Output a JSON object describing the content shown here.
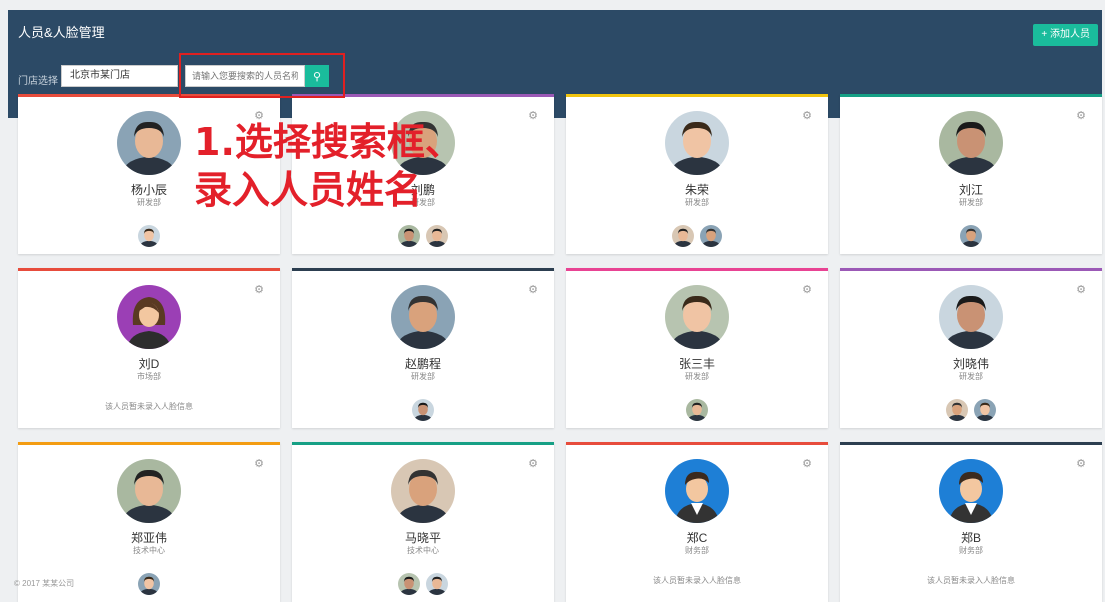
{
  "header": {
    "title": "人员&人脸管理",
    "add_button": "+ 添加人员",
    "filter_label": "门店选择",
    "store_select": "北京市某门店",
    "search_placeholder": "请输入您要搜索的人员名称",
    "search_icon": "search-icon"
  },
  "annotation": {
    "line1": "1.选择搜索框、",
    "line2": "录入人员姓名",
    "color": "#e3202a"
  },
  "cards": [
    {
      "name": "杨小辰",
      "dept": "研发部",
      "border": "#e74c3c",
      "avatar": "photo",
      "thumbs": 1,
      "note": ""
    },
    {
      "name": "刘鹏",
      "dept": "研发部",
      "border": "#9b59b6",
      "avatar": "photo",
      "thumbs": 2,
      "note": ""
    },
    {
      "name": "朱荣",
      "dept": "研发部",
      "border": "#f1c40f",
      "avatar": "photo",
      "thumbs": 2,
      "note": ""
    },
    {
      "name": "刘江",
      "dept": "研发部",
      "border": "#16a085",
      "avatar": "photo",
      "thumbs": 1,
      "note": ""
    },
    {
      "name": "刘D",
      "dept": "市场部",
      "border": "#e74c3c",
      "avatar": "female-cartoon",
      "thumbs": 0,
      "note": "该人员暂未录入人脸信息"
    },
    {
      "name": "赵鹏程",
      "dept": "研发部",
      "border": "#2c3e50",
      "avatar": "photo",
      "thumbs": 1,
      "note": ""
    },
    {
      "name": "张三丰",
      "dept": "研发部",
      "border": "#e84393",
      "avatar": "photo",
      "thumbs": 1,
      "note": ""
    },
    {
      "name": "刘晓伟",
      "dept": "研发部",
      "border": "#9b59b6",
      "avatar": "photo",
      "thumbs": 2,
      "note": ""
    },
    {
      "name": "郑亚伟",
      "dept": "技术中心",
      "border": "#f39c12",
      "avatar": "photo",
      "thumbs": 1,
      "note": ""
    },
    {
      "name": "马晓平",
      "dept": "技术中心",
      "border": "#16a085",
      "avatar": "photo",
      "thumbs": 2,
      "note": ""
    },
    {
      "name": "郑C",
      "dept": "财务部",
      "border": "#e74c3c",
      "avatar": "male-cartoon",
      "thumbs": 0,
      "note": "该人员暂未录入人脸信息"
    },
    {
      "name": "郑B",
      "dept": "财务部",
      "border": "#2c3e50",
      "avatar": "male-cartoon",
      "thumbs": 0,
      "note": "该人员暂未录入人脸信息"
    }
  ],
  "footer": "© 2017 某某公司",
  "colors": {
    "header_bg": "#2c4a66",
    "accent": "#1abc9c",
    "page_bg": "#eef0f2"
  }
}
